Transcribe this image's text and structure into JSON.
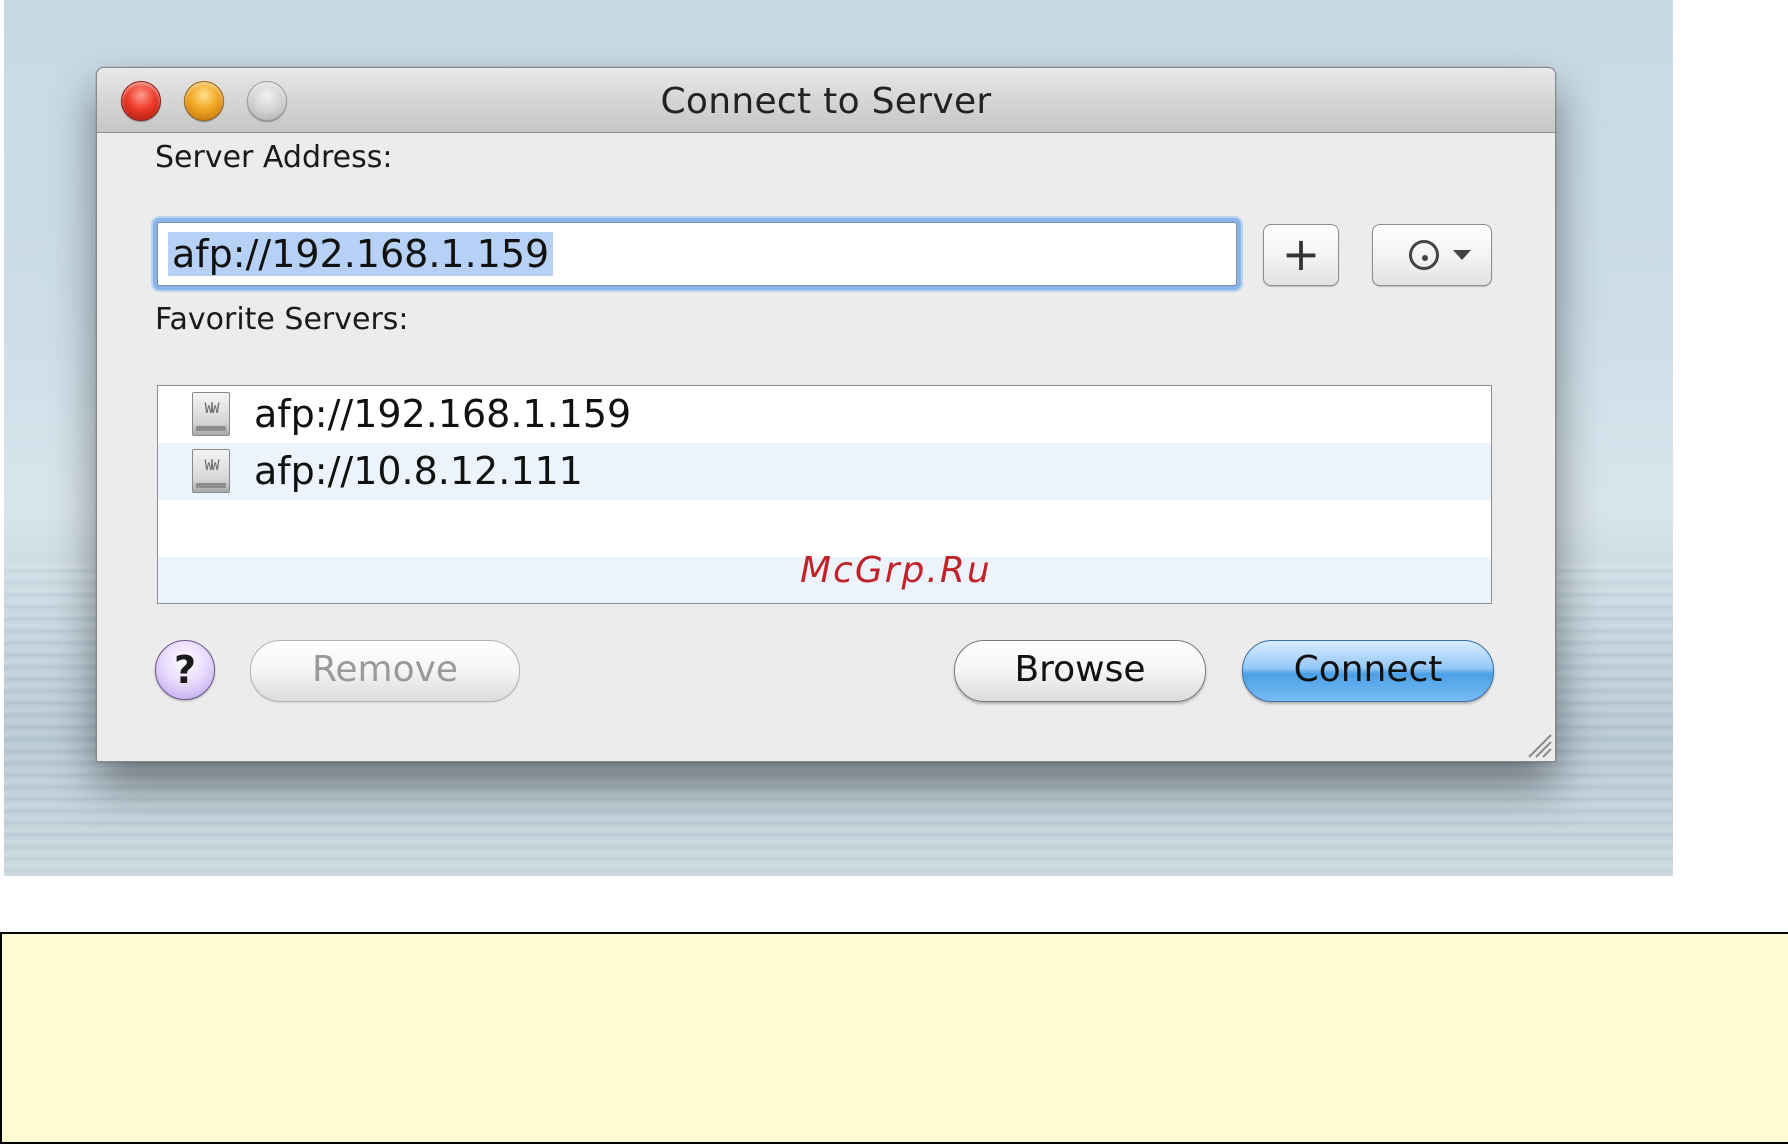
{
  "window": {
    "title": "Connect to Server",
    "server_address_label": "Server Address:",
    "server_address_value": "afp://192.168.1.159",
    "add_button_label": "+",
    "favorites_label": "Favorite Servers:",
    "favorites": [
      {
        "address": "afp://192.168.1.159",
        "icon": "server-icon"
      },
      {
        "address": "afp://10.8.12.111",
        "icon": "server-icon"
      }
    ],
    "help_label": "?",
    "remove_label": "Remove",
    "browse_label": "Browse",
    "connect_label": "Connect"
  },
  "watermark": "McGrp.Ru",
  "colors": {
    "selection": "#b6d1f5",
    "connect_button": "#4c9fe6",
    "note_background": "#fffbd1",
    "watermark": "#c0242a"
  }
}
